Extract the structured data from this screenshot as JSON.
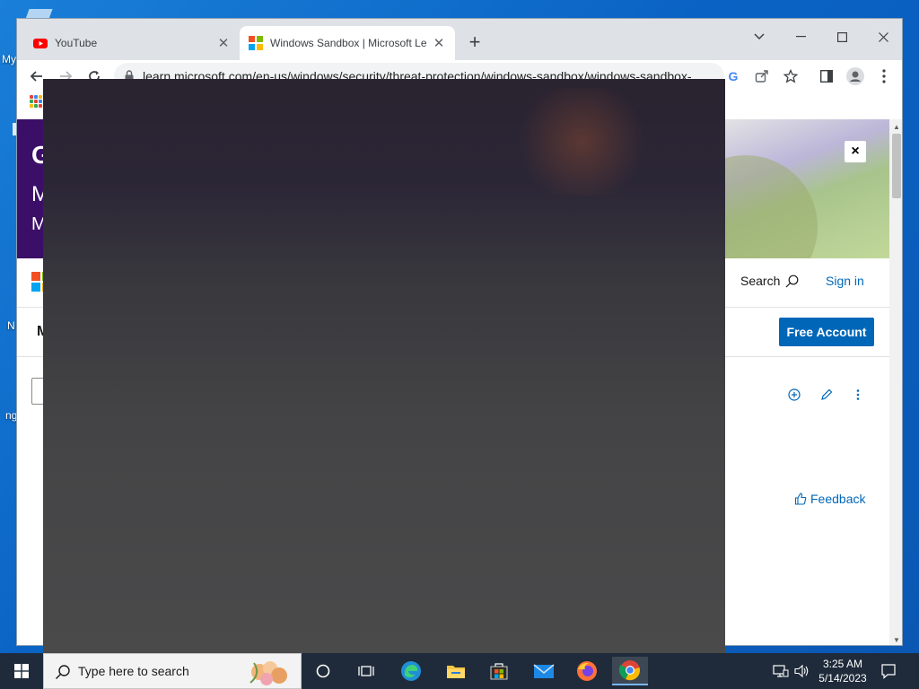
{
  "desktop": {
    "fragments": [
      "My",
      "N",
      "ng"
    ]
  },
  "browser": {
    "tabs": [
      {
        "title": "YouTube",
        "favicon": "youtube-icon",
        "active": false
      },
      {
        "title": "Windows Sandbox | Microsoft Le",
        "favicon": "microsoft-icon",
        "active": true
      }
    ],
    "new_tab_label": "+",
    "address": "learn.microsoft.com/en-us/windows/security/threat-protection/windows-sandbox/windows-sandbox-..."
  },
  "page": {
    "banner_letters": [
      "G",
      "M",
      "M"
    ],
    "banner_close": "×",
    "header": {
      "search_label": "Search",
      "signin_label": "Sign in"
    },
    "nav_fragment": "M",
    "free_account_label": "Free Account",
    "feedback_label": "Feedback"
  },
  "taskbar": {
    "search_placeholder": "Type here to search",
    "apps": [
      "cortana",
      "task-view",
      "edge",
      "file-explorer",
      "microsoft-store",
      "mail",
      "firefox",
      "chrome"
    ],
    "time": "3:25 AM",
    "date": "5/14/2023"
  },
  "colors": {
    "accent": "#0067b8",
    "banner": "#3b0f67",
    "taskbar": "#1f2b3a"
  }
}
